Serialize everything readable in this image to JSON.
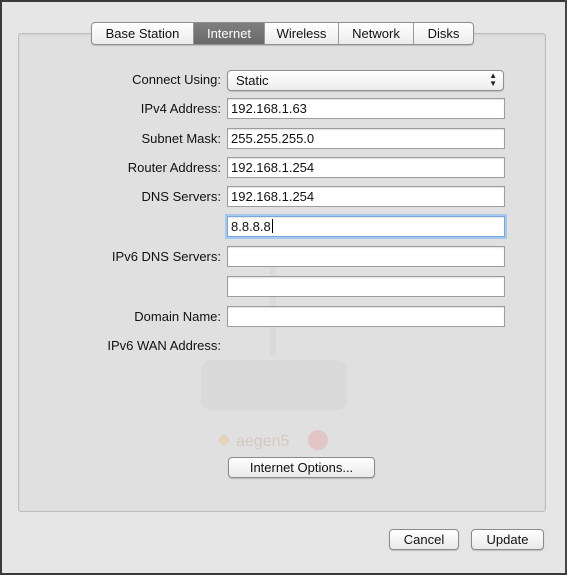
{
  "tabs": [
    {
      "label": "Base Station",
      "active": false
    },
    {
      "label": "Internet",
      "active": true
    },
    {
      "label": "Wireless",
      "active": false
    },
    {
      "label": "Network",
      "active": false
    },
    {
      "label": "Disks",
      "active": false
    }
  ],
  "form": {
    "connect_using_label": "Connect Using:",
    "connect_using_value": "Static",
    "ipv4_label": "IPv4 Address:",
    "ipv4_value": "192.168.1.63",
    "subnet_label": "Subnet Mask:",
    "subnet_value": "255.255.255.0",
    "router_label": "Router Address:",
    "router_value": "192.168.1.254",
    "dns_label": "DNS Servers:",
    "dns1_value": "192.168.1.254",
    "dns2_value": "8.8.8.8",
    "ipv6_dns_label": "IPv6 DNS Servers:",
    "ipv6_dns1_value": "",
    "ipv6_dns2_value": "",
    "domain_label": "Domain Name:",
    "domain_value": "",
    "ipv6_wan_label": "IPv6 WAN Address:"
  },
  "buttons": {
    "internet_options": "Internet Options...",
    "cancel": "Cancel",
    "update": "Update"
  },
  "background_device_name": "aegen5",
  "colors": {
    "active_tab_bg": "#737373",
    "focus_ring": "#a7c8ee"
  }
}
